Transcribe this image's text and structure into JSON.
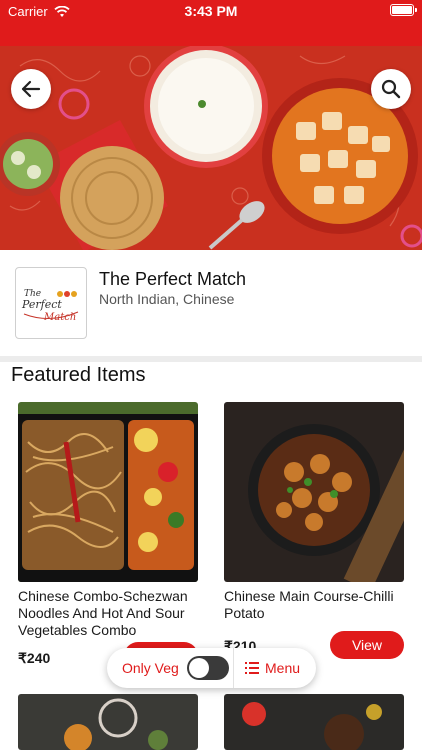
{
  "status_bar": {
    "carrier": "Carrier",
    "time": "3:43 PM",
    "battery_level": 1.0
  },
  "restaurant": {
    "name": "The Perfect Match",
    "cuisine": "North Indian, Chinese",
    "logo_text": "The Perfect Match"
  },
  "section_title": "Featured Items",
  "items": [
    {
      "title": "Chinese Combo-Schezwan Noodles And Hot And Sour Vegetables Combo",
      "price": "₹240",
      "view_label": "View"
    },
    {
      "title": "Chinese Main Course-Chilli Potato",
      "price": "₹210",
      "view_label": "View"
    }
  ],
  "filter_bar": {
    "veg_label": "Only Veg",
    "veg_on": false,
    "menu_label": "Menu"
  },
  "colors": {
    "brand": "#e01b1b",
    "banner": "#c9301f",
    "toggle_off": "#3a3a3a"
  },
  "icons": [
    "wifi-icon",
    "battery-icon",
    "back-arrow-icon",
    "search-icon",
    "menu-list-icon"
  ]
}
